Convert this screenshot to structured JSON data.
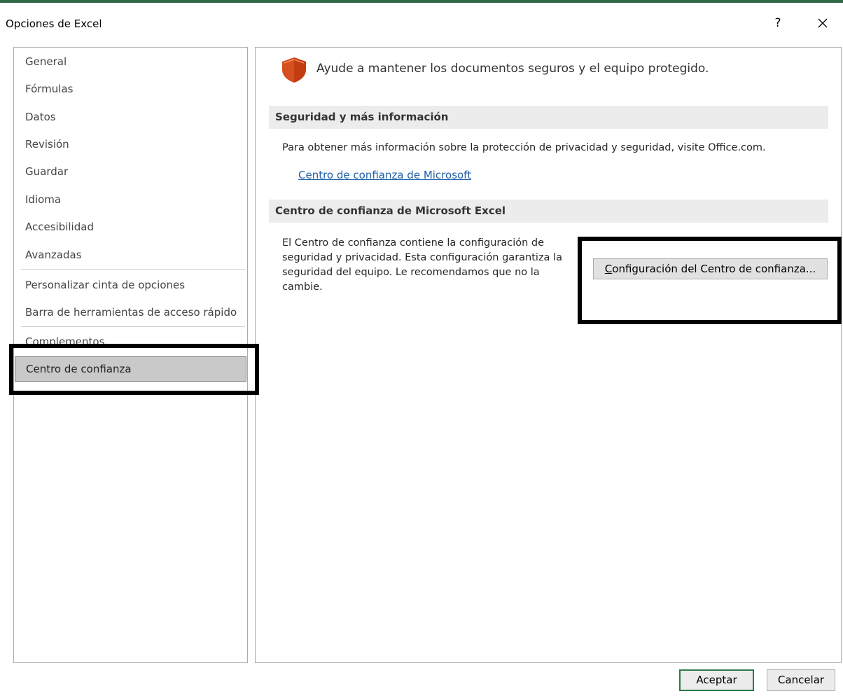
{
  "window": {
    "title": "Opciones de Excel",
    "help_label": "?"
  },
  "nav": {
    "items": [
      {
        "label": "General"
      },
      {
        "label": "Fórmulas"
      },
      {
        "label": "Datos"
      },
      {
        "label": "Revisión"
      },
      {
        "label": "Guardar"
      },
      {
        "label": "Idioma"
      },
      {
        "label": "Accesibilidad"
      },
      {
        "label": "Avanzadas"
      },
      {
        "label": "Personalizar cinta de opciones"
      },
      {
        "label": "Barra de herramientas de acceso rápido"
      },
      {
        "label": "Complementos"
      },
      {
        "label": "Centro de confianza"
      }
    ],
    "selected": "Centro de confianza"
  },
  "main": {
    "intro": "Ayude a mantener los documentos seguros y el equipo protegido.",
    "intro_icon": "shield-icon",
    "section1": {
      "header": "Seguridad y más información",
      "text": "Para obtener más información sobre la protección de privacidad y seguridad, visite Office.com.",
      "link": "Centro de confianza de Microsoft"
    },
    "section2": {
      "header": "Centro de confianza de Microsoft Excel",
      "text": "El Centro de confianza contiene la configuración de seguridad y privacidad. Esta configuración garantiza la seguridad del equipo. Le recomendamos que no la cambie.",
      "button_accel": "C",
      "button_rest": "onfiguración del Centro de confianza..."
    }
  },
  "footer": {
    "ok_label": "Aceptar",
    "cancel_label": "Cancelar"
  },
  "colors": {
    "accent": "#2f7a4a",
    "link": "#1e5fa8",
    "shield": "#d64f1e"
  }
}
